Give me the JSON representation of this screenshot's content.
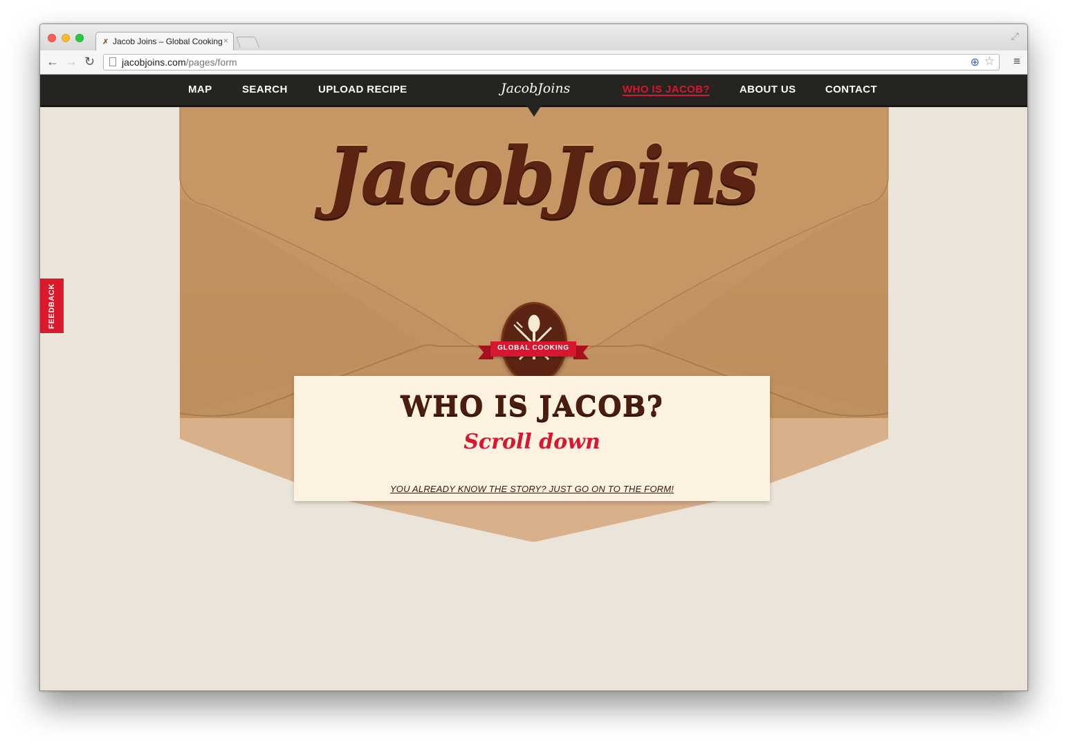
{
  "browser": {
    "tab_title": "Jacob Joins – Global Cooking",
    "tab_close": "×",
    "tab_favicon": "✗",
    "url_host": "jacobjoins.com",
    "url_path": "/pages/form",
    "back": "←",
    "forward": "→",
    "reload": "↻",
    "menu": "≡",
    "bookmark_star": "☆",
    "target": "⊕",
    "fullscreen": "⤢"
  },
  "nav": {
    "items": [
      {
        "label": "MAP"
      },
      {
        "label": "SEARCH"
      },
      {
        "label": "UPLOAD RECIPE"
      },
      {
        "label": "WHO IS JACOB?",
        "active": true
      },
      {
        "label": "ABOUT US"
      },
      {
        "label": "CONTACT"
      }
    ],
    "logo": "JacobJoins"
  },
  "feedback": {
    "label": "FEEDBACK"
  },
  "hero": {
    "logo": "JacobJoins",
    "badge_label": "GLOBAL COOKING",
    "badge_icon": "fork-spoon-knife-icon"
  },
  "card": {
    "title": "WHO IS JACOB?",
    "subtitle": "Scroll down",
    "link": "YOU ALREADY KNOW THE STORY? JUST GO ON TO THE FORM!"
  },
  "colors": {
    "accent": "#d7172f",
    "brown_dark": "#5b2412",
    "envelope": "#c39462",
    "card_bg": "#fdf2e0",
    "nav_bg": "#262421",
    "page_bg": "#ebe4d9"
  }
}
